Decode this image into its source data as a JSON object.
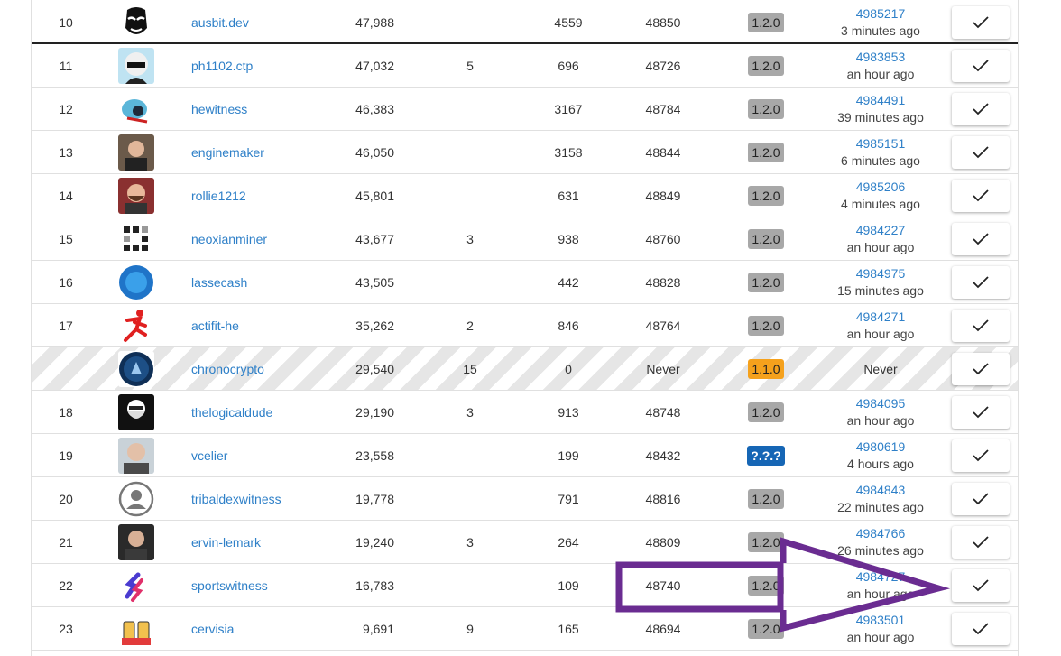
{
  "rows": [
    {
      "rank": "10",
      "name": "ausbit.dev",
      "votes": "47,988",
      "missed": "",
      "last_block_sign": "4559",
      "block_height": "48850",
      "version": "1.2.0",
      "version_style": "gray",
      "price_link": "4985217",
      "price_time": "3 minutes ago",
      "avatar": "mask",
      "striped": false,
      "first": true
    },
    {
      "rank": "11",
      "name": "ph1102.ctp",
      "votes": "47,032",
      "missed": "5",
      "last_block_sign": "696",
      "block_height": "48726",
      "version": "1.2.0",
      "version_style": "gray",
      "price_link": "4983853",
      "price_time": "an hour ago",
      "avatar": "hood"
    },
    {
      "rank": "12",
      "name": "hewitness",
      "votes": "46,383",
      "missed": "",
      "last_block_sign": "3167",
      "block_height": "48784",
      "version": "1.2.0",
      "version_style": "gray",
      "price_link": "4984491",
      "price_time": "39 minutes ago",
      "avatar": "ninja"
    },
    {
      "rank": "13",
      "name": "enginemaker",
      "votes": "46,050",
      "missed": "",
      "last_block_sign": "3158",
      "block_height": "48844",
      "version": "1.2.0",
      "version_style": "gray",
      "price_link": "4985151",
      "price_time": "6 minutes ago",
      "avatar": "man1"
    },
    {
      "rank": "14",
      "name": "rollie1212",
      "votes": "45,801",
      "missed": "",
      "last_block_sign": "631",
      "block_height": "48849",
      "version": "1.2.0",
      "version_style": "gray",
      "price_link": "4985206",
      "price_time": "4 minutes ago",
      "avatar": "man2"
    },
    {
      "rank": "15",
      "name": "neoxianminer",
      "votes": "43,677",
      "missed": "3",
      "last_block_sign": "938",
      "block_height": "48760",
      "version": "1.2.0",
      "version_style": "gray",
      "price_link": "4984227",
      "price_time": "an hour ago",
      "avatar": "dots"
    },
    {
      "rank": "16",
      "name": "lassecash",
      "votes": "43,505",
      "missed": "",
      "last_block_sign": "442",
      "block_height": "48828",
      "version": "1.2.0",
      "version_style": "gray",
      "price_link": "4984975",
      "price_time": "15 minutes ago",
      "avatar": "bluecoin"
    },
    {
      "rank": "17",
      "name": "actifit-he",
      "votes": "35,262",
      "missed": "2",
      "last_block_sign": "846",
      "block_height": "48764",
      "version": "1.2.0",
      "version_style": "gray",
      "price_link": "4984271",
      "price_time": "an hour ago",
      "avatar": "runner"
    },
    {
      "rank": "",
      "name": "chronocrypto",
      "votes": "29,540",
      "missed": "15",
      "last_block_sign": "0",
      "block_height": "Never",
      "version": "1.1.0",
      "version_style": "orange",
      "price_link": "",
      "price_time": "",
      "price_never": "Never",
      "avatar": "emblem",
      "striped": true
    },
    {
      "rank": "18",
      "name": "thelogicaldude",
      "votes": "29,190",
      "missed": "3",
      "last_block_sign": "913",
      "block_height": "48748",
      "version": "1.2.0",
      "version_style": "gray",
      "price_link": "4984095",
      "price_time": "an hour ago",
      "avatar": "beard"
    },
    {
      "rank": "19",
      "name": "vcelier",
      "votes": "23,558",
      "missed": "",
      "last_block_sign": "199",
      "block_height": "48432",
      "version": "?.?.?",
      "version_style": "blue",
      "price_link": "4980619",
      "price_time": "4 hours ago",
      "avatar": "man3"
    },
    {
      "rank": "20",
      "name": "tribaldexwitness",
      "votes": "19,778",
      "missed": "",
      "last_block_sign": "791",
      "block_height": "48816",
      "version": "1.2.0",
      "version_style": "gray",
      "price_link": "4984843",
      "price_time": "22 minutes ago",
      "avatar": "placeholder"
    },
    {
      "rank": "21",
      "name": "ervin-lemark",
      "votes": "19,240",
      "missed": "3",
      "last_block_sign": "264",
      "block_height": "48809",
      "version": "1.2.0",
      "version_style": "gray",
      "price_link": "4984766",
      "price_time": "26 minutes ago",
      "avatar": "man4"
    },
    {
      "rank": "22",
      "name": "sportswitness",
      "votes": "16,783",
      "missed": "",
      "last_block_sign": "109",
      "block_height": "48740",
      "version": "1.2.0",
      "version_style": "gray",
      "price_link": "4984727",
      "price_time": "an hour ago",
      "avatar": "sports"
    },
    {
      "rank": "23",
      "name": "cervisia",
      "votes": "9,691",
      "missed": "9",
      "last_block_sign": "165",
      "block_height": "48694",
      "version": "1.2.0",
      "version_style": "gray",
      "price_link": "4983501",
      "price_time": "an hour ago",
      "avatar": "beer"
    }
  ],
  "approve_icon": "checkmark-icon",
  "annotation_colors": {
    "arrow": "#6a2c91",
    "box": "#6a2c91"
  }
}
